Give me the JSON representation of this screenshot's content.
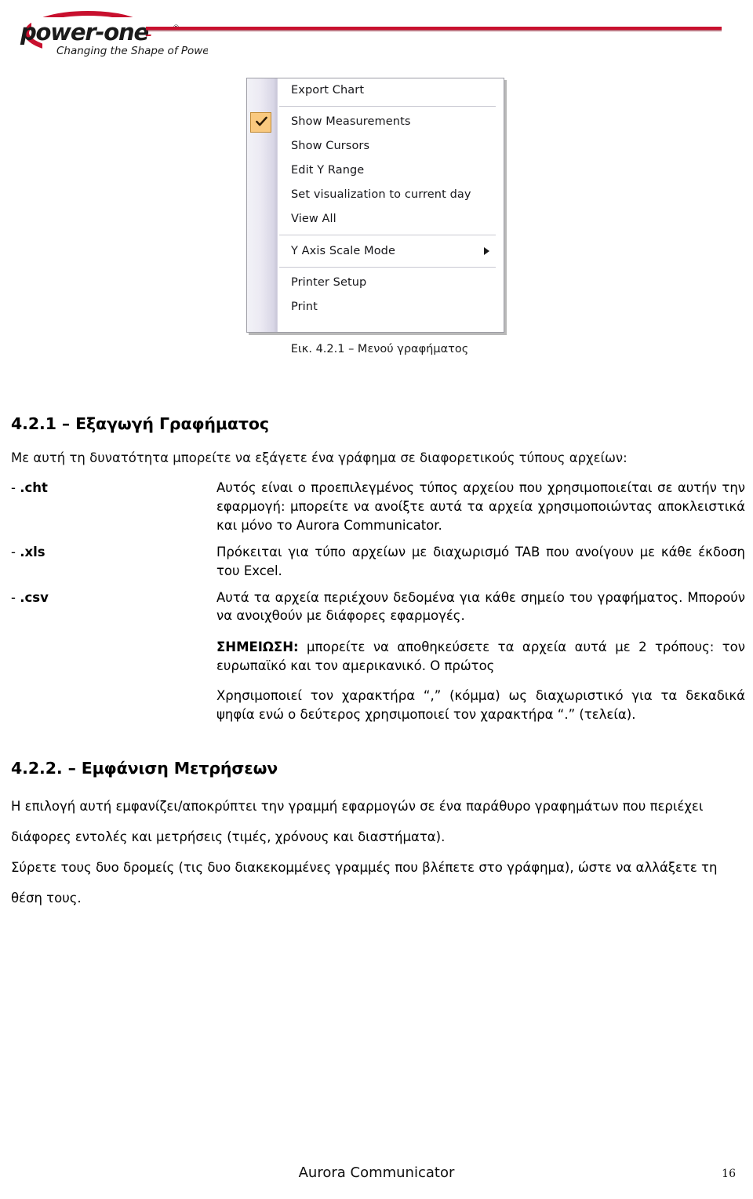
{
  "header": {
    "logo_name": "power-one",
    "logo_tagline": "Changing the Shape of Power",
    "logo_trademark": "®",
    "rule_color": "#c8102e"
  },
  "figure": {
    "caption": "Εικ. 4.2.1 – Μενού γραφήματος",
    "menu": {
      "checked_item_index": 1,
      "check_color": "#f9c97f",
      "items": [
        {
          "label": "Export Chart",
          "checked": false,
          "submenu": false,
          "separator_after": true
        },
        {
          "label": "Show Measurements",
          "checked": true,
          "submenu": false,
          "separator_after": false
        },
        {
          "label": "Show Cursors",
          "checked": false,
          "submenu": false,
          "separator_after": false
        },
        {
          "label": "Edit Y Range",
          "checked": false,
          "submenu": false,
          "separator_after": false
        },
        {
          "label": "Set visualization to current day",
          "checked": false,
          "submenu": false,
          "separator_after": false
        },
        {
          "label": "View All",
          "checked": false,
          "submenu": false,
          "separator_after": true
        },
        {
          "label": "Y Axis Scale Mode",
          "checked": false,
          "submenu": true,
          "separator_after": true
        },
        {
          "label": "Printer Setup",
          "checked": false,
          "submenu": false,
          "separator_after": false
        },
        {
          "label": "Print",
          "checked": false,
          "submenu": false,
          "separator_after": false
        }
      ]
    }
  },
  "section1": {
    "heading": "4.2.1 – Εξαγωγή Γραφήματος",
    "intro": "Με αυτή τη δυνατότητα μπορείτε να εξάγετε ένα γράφημα σε διαφορετικούς τύπους αρχείων:",
    "entries": [
      {
        "marker": "-",
        "term": ".cht",
        "description": "Αυτός είναι ο προεπιλεγμένος τύπος αρχείου που χρησιμοποιείται σε αυτήν την εφαρμογή: μπορείτε να ανοίξτε αυτά τα αρχεία χρησιμοποιώντας αποκλειστικά και μόνο το Aurora Communicator."
      },
      {
        "marker": "-",
        "term": ".xls",
        "description": "Πρόκειται για τύπο αρχείων με διαχωρισμό TAB που ανοίγουν με κάθε έκδοση του Excel."
      },
      {
        "marker": "-",
        "term": ".csv",
        "description": "Αυτά τα αρχεία περιέχουν δεδομένα για κάθε σημείο του γραφήματος. Μπορούν να ανοιχθούν με διάφορες εφαρμογές."
      }
    ],
    "note_label": "ΣΗΜΕΙΩΣΗ:",
    "note_text": " μπορείτε να αποθηκεύσετε τα αρχεία αυτά με 2 τρόπους: τον ευρωπαϊκό και τον αμερικανικό. Ο πρώτος",
    "note_text2": "Χρησιμοποιεί τον χαρακτήρα “,” (κόμμα) ως διαχωριστικό για τα δεκαδικά ψηφία ενώ ο δεύτερος χρησιμοποιεί τον χαρακτήρα “.” (τελεία)."
  },
  "section2": {
    "heading": "4.2.2. – Εμφάνιση Μετρήσεων",
    "para1": "Η επιλογή αυτή εμφανίζει/αποκρύπτει την γραμμή εφαρμογών σε ένα παράθυρο γραφημάτων που περιέχει",
    "para2": "διάφορες εντολές και μετρήσεις (τιμές, χρόνους και διαστήματα).",
    "para3": "Σύρετε τους δυο δρομείς (τις δυο διακεκομμένες γραμμές που βλέπετε στο γράφημα), ώστε να αλλάξετε τη",
    "para4": "θέση τους."
  },
  "footer": {
    "title": "Aurora Communicator",
    "page": "16"
  }
}
